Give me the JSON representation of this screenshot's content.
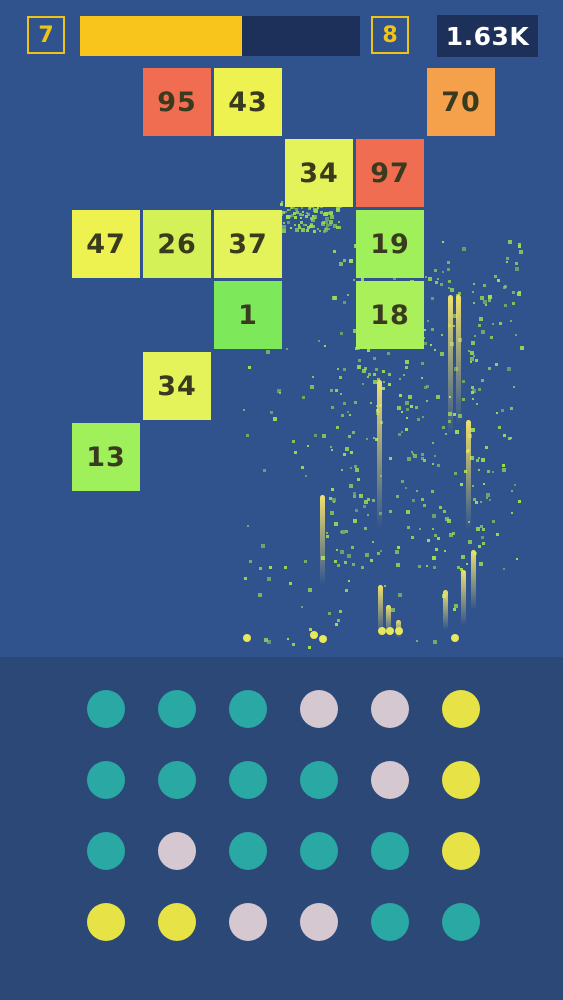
{
  "hud": {
    "level_current": "7",
    "level_next": "8",
    "level_progress": 0.58,
    "score": "1.63K"
  },
  "colors": {
    "playfield": "#30538e",
    "tray": "#2b4877",
    "accent": "#f0c318",
    "teal": "#2aa8a3",
    "pink": "#d6c8d1",
    "yellow": "#e7e347"
  },
  "blocks": [
    {
      "value": "95",
      "col": 2,
      "row": 0,
      "color": "#f16d52"
    },
    {
      "value": "43",
      "col": 3,
      "row": 0,
      "color": "#eef250"
    },
    {
      "value": "70",
      "col": 6,
      "row": 0,
      "color": "#f5a04a"
    },
    {
      "value": "34",
      "col": 4,
      "row": 1,
      "color": "#e5f35b"
    },
    {
      "value": "97",
      "col": 5,
      "row": 1,
      "color": "#f16d52"
    },
    {
      "value": "47",
      "col": 1,
      "row": 2,
      "color": "#eef250"
    },
    {
      "value": "26",
      "col": 2,
      "row": 2,
      "color": "#d5f158"
    },
    {
      "value": "37",
      "col": 3,
      "row": 2,
      "color": "#e5f35b"
    },
    {
      "value": "19",
      "col": 5,
      "row": 2,
      "color": "#9ff05a"
    },
    {
      "value": "1",
      "col": 3,
      "row": 3,
      "color": "#7ee85b"
    },
    {
      "value": "18",
      "col": 5,
      "row": 3,
      "color": "#a9f05a"
    },
    {
      "value": "34",
      "col": 2,
      "row": 4,
      "color": "#e5f35b"
    },
    {
      "value": "13",
      "col": 1,
      "row": 5,
      "color": "#9ff05a"
    }
  ],
  "dots": [
    [
      "teal",
      "teal",
      "teal",
      "pink",
      "pink",
      "yellow"
    ],
    [
      "teal",
      "teal",
      "teal",
      "teal",
      "pink",
      "yellow"
    ],
    [
      "teal",
      "pink",
      "teal",
      "teal",
      "teal",
      "yellow"
    ],
    [
      "yellow",
      "yellow",
      "pink",
      "pink",
      "teal",
      "teal"
    ]
  ]
}
